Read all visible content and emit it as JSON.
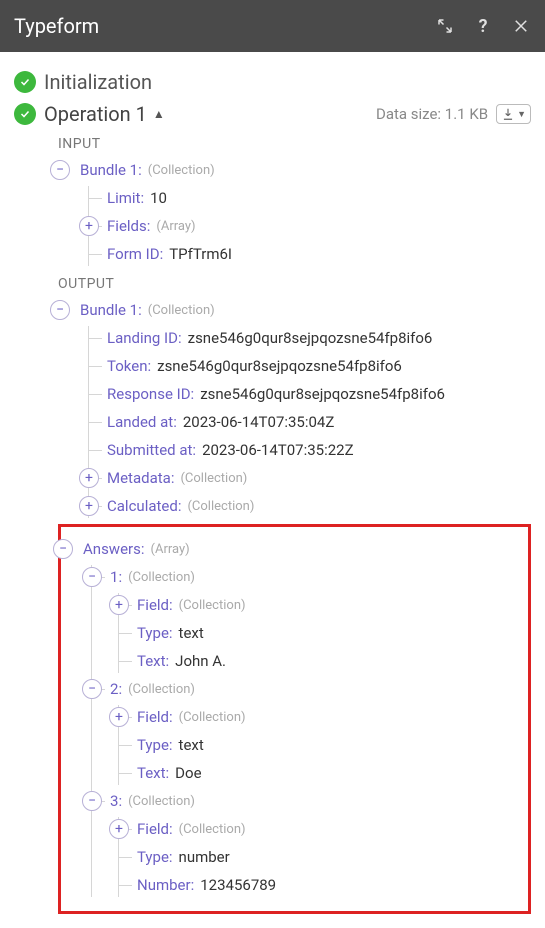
{
  "header": {
    "title": "Typeform"
  },
  "steps": {
    "init": "Initialization",
    "op1": "Operation 1"
  },
  "dataSize": "Data size: 1.1 KB",
  "labels": {
    "input": "INPUT",
    "output": "OUTPUT",
    "collection": "(Collection)",
    "array": "(Array)"
  },
  "input": {
    "bundle1": {
      "label": "Bundle 1",
      "limit": {
        "k": "Limit",
        "v": "10"
      },
      "fields": {
        "k": "Fields"
      },
      "formId": {
        "k": "Form ID",
        "v": "TPfTrm6I"
      }
    }
  },
  "output": {
    "bundle1": {
      "label": "Bundle 1",
      "landingId": {
        "k": "Landing ID",
        "v": "zsne546g0qur8sejpqozsne54fp8ifo6"
      },
      "token": {
        "k": "Token",
        "v": "zsne546g0qur8sejpqozsne54fp8ifo6"
      },
      "responseId": {
        "k": "Response ID",
        "v": "zsne546g0qur8sejpqozsne54fp8ifo6"
      },
      "landedAt": {
        "k": "Landed at",
        "v": "2023-06-14T07:35:04Z"
      },
      "submittedAt": {
        "k": "Submitted at",
        "v": "2023-06-14T07:35:22Z"
      },
      "metadata": {
        "k": "Metadata"
      },
      "calculated": {
        "k": "Calculated"
      },
      "answers": {
        "k": "Answers",
        "items": [
          {
            "n": "1",
            "field": "Field",
            "type": {
              "k": "Type",
              "v": "text"
            },
            "val": {
              "k": "Text",
              "v": "John A."
            }
          },
          {
            "n": "2",
            "field": "Field",
            "type": {
              "k": "Type",
              "v": "text"
            },
            "val": {
              "k": "Text",
              "v": "Doe"
            }
          },
          {
            "n": "3",
            "field": "Field",
            "type": {
              "k": "Type",
              "v": "number"
            },
            "val": {
              "k": "Number",
              "v": "123456789"
            }
          }
        ]
      }
    }
  }
}
